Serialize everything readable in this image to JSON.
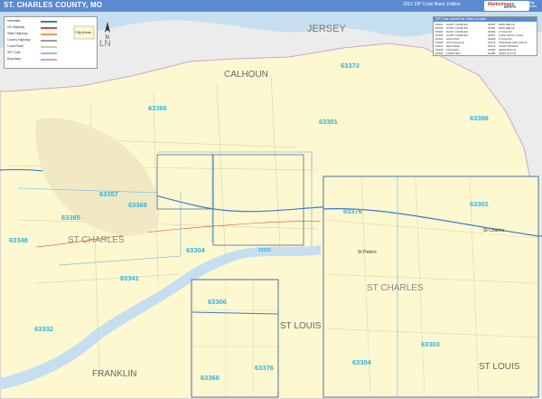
{
  "header": {
    "title": "ST. CHARLES COUNTY, MO",
    "edition": "2021 ZIP Code Basic Edition",
    "brand": "Marketmaps",
    "brand_sub": "MAPS",
    "brand_co": "Map Sales\nwww.mapsales.com"
  },
  "colors": {
    "title_bar": "#5b8ad1",
    "county_fill": "#fdf8cf",
    "water": "#c6dff0",
    "zip_label": "#2bb3e6",
    "outside_land": "#ececec"
  },
  "legend": {
    "rows": [
      "Interstate",
      "US Highway",
      "State Highway",
      "County Highway",
      "Local Road",
      "ZIP Code",
      "Boundary"
    ]
  },
  "compass": {
    "letter": "N"
  },
  "city_badge": {
    "label": "City Areas"
  },
  "zip_index": {
    "title": "ZIP Code Index/Post Office Location",
    "entries": [
      [
        "63301",
        "SAINT CHARLES"
      ],
      [
        "63302",
        "SAINT CHARLES"
      ],
      [
        "63303",
        "SAINT CHARLES"
      ],
      [
        "63304",
        "SAINT CHARLES"
      ],
      [
        "63332",
        "AUGUSTA"
      ],
      [
        "63338",
        "COTTLEVILLE"
      ],
      [
        "63341",
        "DEFIANCE"
      ],
      [
        "63346",
        "FLINTHILL"
      ],
      [
        "63348",
        "FORISTELL"
      ],
      [
        "63357",
        "NEW MELLE"
      ],
      [
        "63365",
        "NEW MELLE"
      ],
      [
        "63366",
        "O FALLON"
      ],
      [
        "63367",
        "LAKE SAINT LOUIS"
      ],
      [
        "63368",
        "O FALLON"
      ],
      [
        "63373",
        "PORTAGE DES SIOUX"
      ],
      [
        "63376",
        "SAINT PETERS"
      ],
      [
        "63385",
        "WENTZVILLE"
      ],
      [
        "63386",
        "WEST ALTON"
      ]
    ]
  },
  "map": {
    "places": [
      {
        "name": "JERSEY"
      },
      {
        "name": "CALHOUN"
      },
      {
        "name": "ST CHARLES"
      },
      {
        "name": "FRANKLIN"
      },
      {
        "name": "ST LOUIS"
      },
      {
        "name": "ST LOUIS"
      },
      {
        "name": "ST CHARLES"
      },
      {
        "name": "LN"
      },
      {
        "name": "St Peters"
      },
      {
        "name": "St Charles"
      }
    ],
    "zips": [
      "63373",
      "63366",
      "63301",
      "63386",
      "63357",
      "63368",
      "63385",
      "63348",
      "63304",
      "63302",
      "63341",
      "63332",
      "63366",
      "63376",
      "63368",
      "63376",
      "63301",
      "63303",
      "63304"
    ]
  }
}
